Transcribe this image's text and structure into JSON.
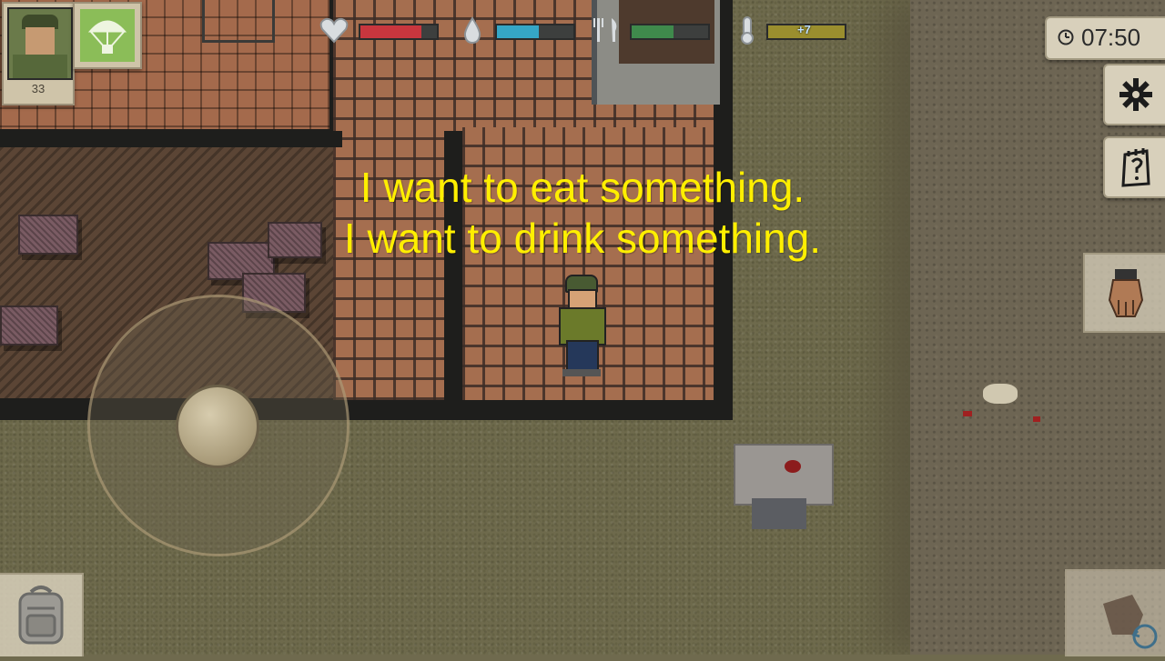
{
  "hud": {
    "player_level": "33",
    "clock_time": "07:50",
    "stats": {
      "health": {
        "level": 0.8,
        "color": "#c9363e"
      },
      "thirst": {
        "level": 0.55,
        "color": "#35a6c6"
      },
      "hunger": {
        "level": 0.55,
        "color": "#3f8a4c"
      },
      "temperature": {
        "value": "+7",
        "color": "#9a8e2e"
      }
    }
  },
  "speech": {
    "line1": "I want to eat something.",
    "line2": "I want to drink something.",
    "color": "#ffef00"
  },
  "icons": {
    "airdrop": "parachute-icon",
    "settings": "gear-icon",
    "quests": "notepad-icon",
    "interact": "hand-icon",
    "inventory": "backpack-icon",
    "swap": "swap-icon",
    "clock": "clock-icon"
  }
}
